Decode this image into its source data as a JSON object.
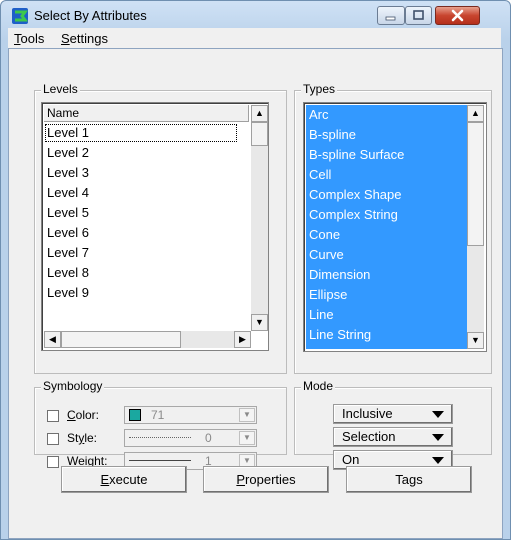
{
  "window": {
    "title": "Select By Attributes",
    "controls": {
      "minimize": "minimize-icon",
      "maximize": "maximize-icon",
      "close": "close-icon"
    }
  },
  "menu": {
    "tools": {
      "hotkey": "T",
      "rest": "ools"
    },
    "settings": {
      "hotkey": "S",
      "rest": "ettings"
    }
  },
  "levels": {
    "group_label": "Levels",
    "column_header": "Name",
    "items": [
      "Level 1",
      "Level 2",
      "Level 3",
      "Level 4",
      "Level 5",
      "Level 6",
      "Level 7",
      "Level 8",
      "Level 9"
    ],
    "focused_item": "Level 1"
  },
  "types": {
    "group_label": "Types",
    "items": [
      "Arc",
      "B-spline",
      "B-spline Surface",
      "Cell",
      "Complex Shape",
      "Complex String",
      "Cone",
      "Curve",
      "Dimension",
      "Ellipse",
      "Line",
      "Line String"
    ],
    "selection_color": "#3399ff"
  },
  "symbology": {
    "group_label": "Symbology",
    "color": {
      "pre": "",
      "hotkey": "C",
      "post": "olor:",
      "value": "71",
      "swatch": "#1aa8a0",
      "checked": false
    },
    "style": {
      "pre": "St",
      "hotkey": "y",
      "post": "le:",
      "value": "0",
      "checked": false
    },
    "weight": {
      "pre": "",
      "hotkey": "W",
      "post": "eight:",
      "value": "1",
      "checked": false
    }
  },
  "mode": {
    "group_label": "Mode",
    "options": [
      "Inclusive",
      "Selection",
      "On"
    ]
  },
  "buttons": {
    "execute": {
      "hotkey": "E",
      "rest": "xecute"
    },
    "properties": {
      "hotkey": "P",
      "rest": "roperties"
    },
    "tags": {
      "pre": "Ta",
      "hotkey": "g",
      "post": "s"
    }
  }
}
